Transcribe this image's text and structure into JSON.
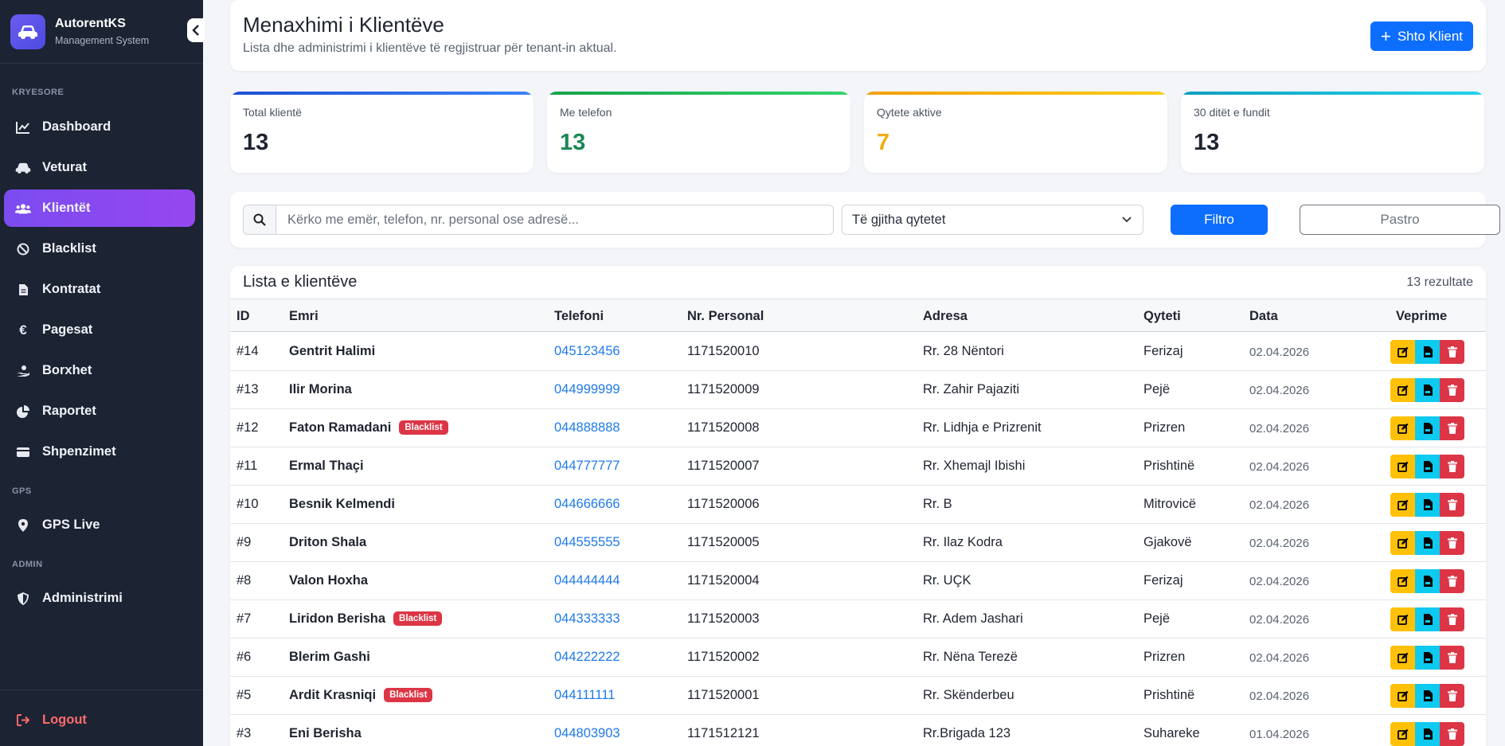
{
  "brand": {
    "name": "AutorentKS",
    "subtitle": "Management System"
  },
  "sidebar": {
    "sections": {
      "main": "KRYESORE",
      "gps": "GPS",
      "admin": "ADMIN"
    },
    "items": [
      {
        "label": "Dashboard",
        "icon": "chart-line-icon"
      },
      {
        "label": "Veturat",
        "icon": "car-icon"
      },
      {
        "label": "Klientët",
        "icon": "users-icon",
        "active": true
      },
      {
        "label": "Blacklist",
        "icon": "ban-icon"
      },
      {
        "label": "Kontratat",
        "icon": "file-icon"
      },
      {
        "label": "Pagesat",
        "icon": "euro-icon"
      },
      {
        "label": "Borxhet",
        "icon": "hand-money-icon"
      },
      {
        "label": "Raportet",
        "icon": "pie-chart-icon"
      },
      {
        "label": "Shpenzimet",
        "icon": "wallet-icon"
      },
      {
        "label": "GPS Live",
        "icon": "map-pin-icon"
      },
      {
        "label": "Administrimi",
        "icon": "shield-icon"
      }
    ],
    "logout": "Logout"
  },
  "header": {
    "title": "Menaxhimi i Klientëve",
    "subtitle": "Lista dhe administrimi i klientëve të regjistruar për tenant-in aktual.",
    "add_button": "Shto Klient"
  },
  "stats": [
    {
      "label": "Total klientë",
      "value": "13",
      "color": "#1f2430",
      "bar": "#0d6efd"
    },
    {
      "label": "Me telefon",
      "value": "13",
      "color": "#198754",
      "bar": "#20c05c"
    },
    {
      "label": "Qytete aktive",
      "value": "7",
      "color": "#f0ad15",
      "bar": "#f5b014"
    },
    {
      "label": "30 ditët e fundit",
      "value": "13",
      "color": "#1f2430",
      "bar": "#18b8d8"
    }
  ],
  "filters": {
    "search_placeholder": "Kërko me emër, telefon, nr. personal ose adresë...",
    "city_selected": "Të gjitha qytetet",
    "filter_button": "Filtro",
    "clear_button": "Pastro"
  },
  "table": {
    "title": "Lista e klientëve",
    "results": "13 rezultate",
    "columns": [
      "ID",
      "Emri",
      "Telefoni",
      "Nr. Personal",
      "Adresa",
      "Qyteti",
      "Data",
      "Veprime"
    ],
    "badge_label": "Blacklist",
    "rows": [
      {
        "id": "#14",
        "name": "Gentrit Halimi",
        "phone": "045123456",
        "personal": "1171520010",
        "address": "Rr. 28 Nëntori",
        "city": "Ferizaj",
        "date": "02.04.2026",
        "blacklist": false
      },
      {
        "id": "#13",
        "name": "Ilir Morina",
        "phone": "044999999",
        "personal": "1171520009",
        "address": "Rr. Zahir Pajaziti",
        "city": "Pejë",
        "date": "02.04.2026",
        "blacklist": false
      },
      {
        "id": "#12",
        "name": "Faton Ramadani",
        "phone": "044888888",
        "personal": "1171520008",
        "address": "Rr. Lidhja e Prizrenit",
        "city": "Prizren",
        "date": "02.04.2026",
        "blacklist": true
      },
      {
        "id": "#11",
        "name": "Ermal Thaçi",
        "phone": "044777777",
        "personal": "1171520007",
        "address": "Rr. Xhemajl Ibishi",
        "city": "Prishtinë",
        "date": "02.04.2026",
        "blacklist": false
      },
      {
        "id": "#10",
        "name": "Besnik Kelmendi",
        "phone": "044666666",
        "personal": "1171520006",
        "address": "Rr. B",
        "city": "Mitrovicë",
        "date": "02.04.2026",
        "blacklist": false
      },
      {
        "id": "#9",
        "name": "Driton Shala",
        "phone": "044555555",
        "personal": "1171520005",
        "address": "Rr. Ilaz Kodra",
        "city": "Gjakovë",
        "date": "02.04.2026",
        "blacklist": false
      },
      {
        "id": "#8",
        "name": "Valon Hoxha",
        "phone": "044444444",
        "personal": "1171520004",
        "address": "Rr. UÇK",
        "city": "Ferizaj",
        "date": "02.04.2026",
        "blacklist": false
      },
      {
        "id": "#7",
        "name": "Liridon Berisha",
        "phone": "044333333",
        "personal": "1171520003",
        "address": "Rr. Adem Jashari",
        "city": "Pejë",
        "date": "02.04.2026",
        "blacklist": true
      },
      {
        "id": "#6",
        "name": "Blerim Gashi",
        "phone": "044222222",
        "personal": "1171520002",
        "address": "Rr. Nëna Terezë",
        "city": "Prizren",
        "date": "02.04.2026",
        "blacklist": false
      },
      {
        "id": "#5",
        "name": "Ardit Krasniqi",
        "phone": "044111111",
        "personal": "1171520001",
        "address": "Rr. Skënderbeu",
        "city": "Prishtinë",
        "date": "02.04.2026",
        "blacklist": true
      },
      {
        "id": "#3",
        "name": "Eni Berisha",
        "phone": "044803903",
        "personal": "1171512121",
        "address": "Rr.Brigada 123",
        "city": "Suhareke",
        "date": "01.04.2026",
        "blacklist": false
      }
    ]
  },
  "colors": {
    "primary": "#0d6efd",
    "sidebar": "#1c2333",
    "active": "#8a49f0",
    "danger": "#dc3545",
    "warning": "#ffc107",
    "info": "#0dcaf0"
  }
}
